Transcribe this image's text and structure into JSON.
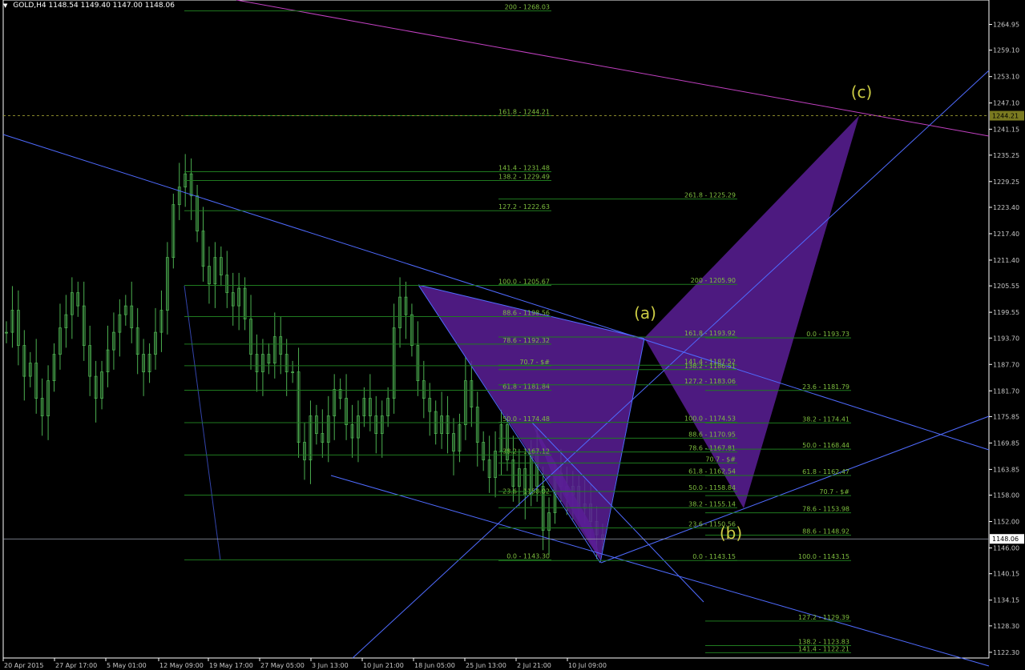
{
  "header": {
    "symbol": "GOLD,H4",
    "ohlc": "1148.54 1149.40 1147.00 1148.06",
    "menu_icon": "triangle-down-icon"
  },
  "colors": {
    "background": "#000000",
    "candle": "#4caf50",
    "fib_line": "#1f7a1f",
    "fib_text": "#7fbf3f",
    "trendline": "#4f6bff",
    "magenta": "#c040c0",
    "pattern_fill": "#5a1e96",
    "point_label": "#cccc44",
    "axis_text": "#c8c8c8"
  },
  "chart_data": {
    "type": "candlestick",
    "symbol": "GOLD",
    "timeframe": "H4",
    "ylim": [
      1122.0,
      1270.0
    ],
    "y_ticks": [
      "1264.95",
      "1259.10",
      "1253.10",
      "1247.10",
      "1241.15",
      "1235.25",
      "1229.25",
      "1223.40",
      "1217.40",
      "1211.40",
      "1205.55",
      "1199.55",
      "1193.70",
      "1187.70",
      "1181.70",
      "1175.85",
      "1169.85",
      "1163.85",
      "1158.00",
      "1152.00",
      "1146.00",
      "1140.15",
      "1134.15",
      "1128.30",
      "1122.30"
    ],
    "x_ticks": [
      "20 Apr 2015",
      "27 Apr 17:00",
      "5 May 01:00",
      "12 May 09:00",
      "19 May 17:00",
      "27 May 05:00",
      "3 Jun 13:00",
      "10 Jun 21:00",
      "18 Jun 05:00",
      "25 Jun 13:00",
      "2 Jul 21:00",
      "10 Jul 09:00"
    ],
    "current_price": "1148.06",
    "target_price": "1244.21",
    "close_series": [
      1195,
      1200,
      1192,
      1185,
      1188,
      1180,
      1176,
      1184,
      1190,
      1196,
      1199,
      1204,
      1201,
      1192,
      1185,
      1180,
      1186,
      1191,
      1195,
      1199,
      1201,
      1196,
      1190,
      1186,
      1190,
      1195,
      1200,
      1212,
      1224,
      1228,
      1231,
      1226,
      1218,
      1210,
      1206,
      1212,
      1208,
      1204,
      1201,
      1205,
      1198,
      1190,
      1186,
      1190,
      1188,
      1194,
      1190,
      1186,
      1186,
      1170,
      1166,
      1176,
      1172,
      1170,
      1176,
      1182,
      1180,
      1174,
      1171,
      1176,
      1180,
      1176,
      1172,
      1176,
      1180,
      1196,
      1203,
      1199,
      1192,
      1184,
      1180,
      1177,
      1172,
      1176,
      1172,
      1168,
      1174,
      1184,
      1178,
      1170,
      1166,
      1162,
      1168,
      1174,
      1166,
      1160,
      1164,
      1158,
      1168,
      1160,
      1150,
      1154,
      1163,
      1160,
      1158,
      1160,
      1155,
      1156,
      1152,
      1149,
      1148
    ],
    "patterns": [
      {
        "points": [
          [
            1205.67,
            0
          ],
          [
            1143.3,
            1
          ],
          [
            1193.73,
            2
          ],
          [
            1155.0,
            3
          ],
          [
            1244.21,
            4
          ]
        ]
      }
    ],
    "point_labels": [
      "(a)",
      "(b)",
      "(c)"
    ],
    "fib_groups": [
      {
        "name": "group1",
        "levels": [
          {
            "label": "200 - 1268.03",
            "price": 1268.03
          },
          {
            "label": "161.8 - 1244.21",
            "price": 1244.21
          },
          {
            "label": "141.4 - 1231.48",
            "price": 1231.48
          },
          {
            "label": "138.2 - 1229.49",
            "price": 1229.49
          },
          {
            "label": "127.2 - 1222.63",
            "price": 1222.63
          },
          {
            "label": "100.0 - 1205.67",
            "price": 1205.67
          },
          {
            "label": "88.6 - 1198.56",
            "price": 1198.56
          },
          {
            "label": "78.6 - 1192.32",
            "price": 1192.32
          },
          {
            "label": "70.7 - $#",
            "price": 1187.4
          },
          {
            "label": "61.8 - 1181.84",
            "price": 1181.84
          },
          {
            "label": "50.0 - 1174.48",
            "price": 1174.48
          },
          {
            "label": "38.2 - 1167.12",
            "price": 1167.12
          },
          {
            "label": "23.6 - 1158.02",
            "price": 1158.02
          },
          {
            "label": "0.0 - 1143.30",
            "price": 1143.3
          }
        ]
      },
      {
        "name": "group2",
        "levels": [
          {
            "label": "261.8 - 1225.29",
            "price": 1225.29
          },
          {
            "label": "200 - 1205.90",
            "price": 1205.9
          },
          {
            "label": "161.8 - 1193.92",
            "price": 1193.92
          },
          {
            "label": "141.4 - 1187.52",
            "price": 1187.52
          },
          {
            "label": "138.2 - 1186.51",
            "price": 1186.51
          },
          {
            "label": "127.2 - 1183.06",
            "price": 1183.06
          },
          {
            "label": "100.0 - 1174.53",
            "price": 1174.53
          },
          {
            "label": "88.6 - 1170.95",
            "price": 1170.95
          },
          {
            "label": "78.6 - 1167.81",
            "price": 1167.81
          },
          {
            "label": "70.7 - $#",
            "price": 1165.3
          },
          {
            "label": "61.8 - 1162.54",
            "price": 1162.54
          },
          {
            "label": "50.0 - 1158.84",
            "price": 1158.84
          },
          {
            "label": "38.2 - 1155.14",
            "price": 1155.14
          },
          {
            "label": "23.6 - 1150.56",
            "price": 1150.56
          },
          {
            "label": "0.0 - 1143.15",
            "price": 1143.15
          }
        ]
      },
      {
        "name": "group3",
        "levels": [
          {
            "label": "0.0 - 1193.73",
            "price": 1193.73
          },
          {
            "label": "23.6 - 1181.79",
            "price": 1181.79
          },
          {
            "label": "38.2 - 1174.41",
            "price": 1174.41
          },
          {
            "label": "50.0 - 1168.44",
            "price": 1168.44
          },
          {
            "label": "61.8 - 1162.47",
            "price": 1162.47
          },
          {
            "label": "70.7 - $#",
            "price": 1157.9
          },
          {
            "label": "78.6 - 1153.98",
            "price": 1153.98
          },
          {
            "label": "88.6 - 1148.92",
            "price": 1148.92
          },
          {
            "label": "100.0 - 1143.15",
            "price": 1143.15
          },
          {
            "label": "127.2 - 1129.39",
            "price": 1129.39
          },
          {
            "label": "138.2 - 1123.83",
            "price": 1123.83
          },
          {
            "label": "141.4 - 1122.21",
            "price": 1122.21
          }
        ]
      }
    ]
  }
}
